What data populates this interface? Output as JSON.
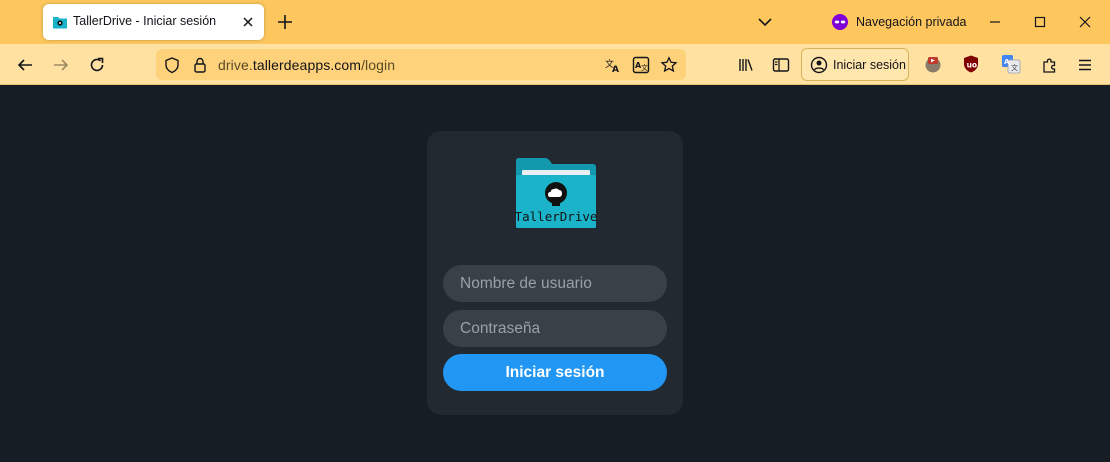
{
  "browser": {
    "tab": {
      "title": "TallerDrive - Iniciar sesión",
      "favicon": "tallerdrive-folder-icon"
    },
    "private_mode_label": "Navegación privada",
    "url": {
      "host": "drive.tallerdeapps.com",
      "host_prefix": "drive.",
      "host_domain": "tallerdeapps.com",
      "path": "/login"
    },
    "account_button_label": "Iniciar sesión",
    "colors": {
      "tab_strip": "#fdc75e",
      "nav_bar": "#ffe2a1",
      "url_bar": "#fdd27a"
    }
  },
  "login": {
    "logo_text": "TallerDrive",
    "username_placeholder": "Nombre de usuario",
    "username_value": "",
    "password_placeholder": "Contraseña",
    "password_value": "",
    "submit_label": "Iniciar sesión",
    "colors": {
      "page_bg": "#171d25",
      "card_bg": "#222931",
      "field_bg": "#3a4048",
      "button": "#2196f3",
      "folder": "#1ab3c9"
    }
  }
}
